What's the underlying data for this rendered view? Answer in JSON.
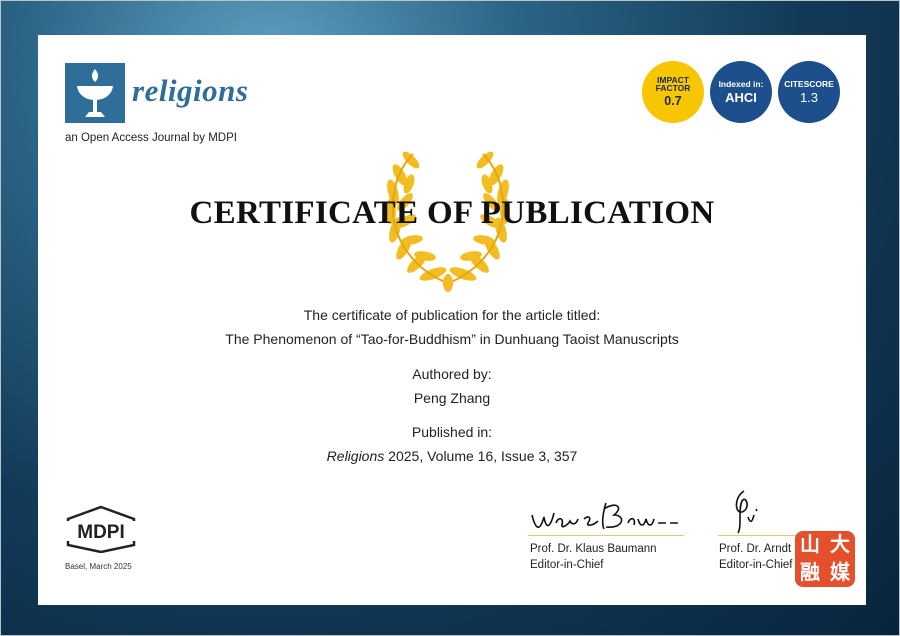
{
  "journal": {
    "name": "religions",
    "subtitle": "an Open Access Journal by MDPI"
  },
  "badges": {
    "impact": {
      "label1": "IMPACT",
      "label2": "FACTOR",
      "value": "0.7",
      "color": "#f7c600"
    },
    "indexed": {
      "label": "Indexed in:",
      "value": "AHCI",
      "color": "#1c4f8c"
    },
    "citescore": {
      "label": "CITESCORE",
      "value": "1.3",
      "color": "#1c4f8c"
    }
  },
  "certificate": {
    "title": "CERTIFICATE OF PUBLICATION",
    "intro": "The certificate of publication for the article titled:",
    "article_title": "The Phenomenon of “Tao-for-Buddhism” in Dunhuang Taoist Manuscripts",
    "authored_label": "Authored by:",
    "author": "Peng Zhang",
    "published_label": "Published in:",
    "journal_italic": "Religions",
    "year": "2025",
    "details": ", Volume 16, Issue 3, 357"
  },
  "publisher": {
    "name": "MDPI",
    "place_date": "Basel, March 2025"
  },
  "signatories": [
    {
      "name": "Prof. Dr. Klaus Baumann",
      "role": "Editor-in-Chief"
    },
    {
      "name": "Prof. Dr. Arndt",
      "role": "Editor-in-Chief"
    }
  ],
  "watermark": {
    "chars": [
      "山",
      "大",
      "融",
      "媒"
    ],
    "color": "#e44f2c"
  },
  "icons": {
    "journal_logo": "chalice-flame-icon",
    "wreath": "laurel-wreath-icon"
  }
}
